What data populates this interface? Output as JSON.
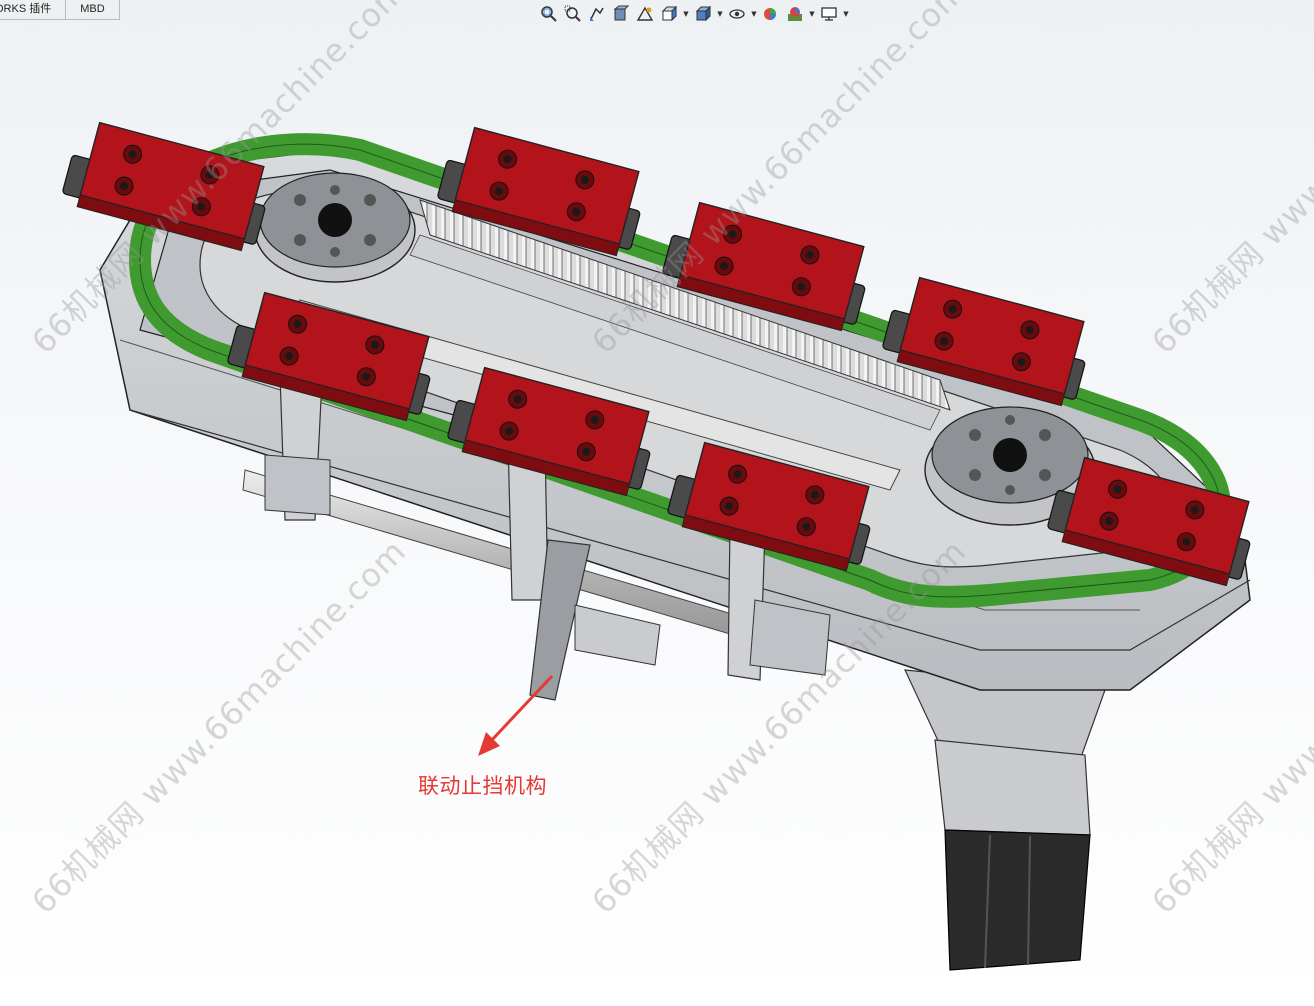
{
  "tabs": [
    {
      "label": "ORKS 插件"
    },
    {
      "label": "MBD"
    }
  ],
  "toolbar": {
    "icons": [
      "zoom-to-fit-icon",
      "zoom-to-area-icon",
      "previous-view-icon",
      "section-view-icon",
      "dynamic-annotation-icon",
      "view-orientation-icon",
      "display-style-icon",
      "hide-show-items-icon",
      "edit-appearance-icon",
      "apply-scene-icon",
      "view-settings-icon"
    ]
  },
  "annotation": {
    "label": "联动止挡机构",
    "color": "#e53935"
  },
  "watermark": {
    "text": "66机械网 www.66machine.com",
    "color": "#969696"
  },
  "colors": {
    "pallet_red": "#b3141b",
    "track_green": "#3f9a2f",
    "frame_grey": "#c9cbce",
    "background": "#eef1f4"
  }
}
